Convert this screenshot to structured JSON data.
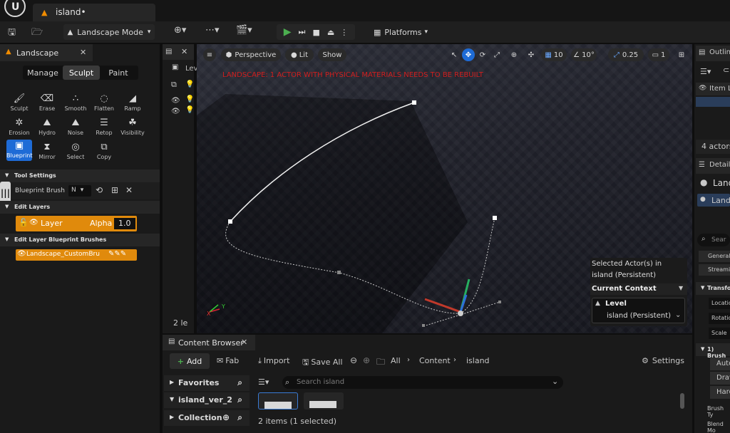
{
  "title_bar": {
    "doc_tab_label": "island•"
  },
  "toolbar": {
    "mode_label": "Landscape Mode",
    "platforms_label": "Platforms"
  },
  "left_panel": {
    "tab_title": "Landscape",
    "modes": [
      "Manage",
      "Sculpt",
      "Paint"
    ],
    "tools": [
      {
        "label": "Sculpt",
        "icon": "brush-icon"
      },
      {
        "label": "Erase",
        "icon": "eraser-icon"
      },
      {
        "label": "Smooth",
        "icon": "smooth-icon"
      },
      {
        "label": "Flatten",
        "icon": "flatten-icon"
      },
      {
        "label": "Ramp",
        "icon": "ramp-icon"
      },
      {
        "label": "Erosion",
        "icon": "erosion-icon"
      },
      {
        "label": "Hydro",
        "icon": "hydro-icon"
      },
      {
        "label": "Noise",
        "icon": "noise-icon"
      },
      {
        "label": "Retop",
        "icon": "retop-icon"
      },
      {
        "label": "Visibility",
        "icon": "visibility-icon"
      },
      {
        "label": "Blueprint",
        "icon": "blueprint-icon"
      },
      {
        "label": "Mirror",
        "icon": "mirror-icon"
      },
      {
        "label": "Select",
        "icon": "select-icon"
      },
      {
        "label": "Copy",
        "icon": "copy-icon"
      }
    ],
    "tool_settings_header": "Tool Settings",
    "blueprint_brush_label": "Blueprint Brush",
    "blueprint_brush_value": "N",
    "edit_layers_header": "Edit Layers",
    "layer_label": "Layer",
    "alpha_label": "Alpha",
    "alpha_value": "1.0",
    "bp_brushes_header": "Edit Layer Blueprint Brushes",
    "bp_brush_item": "Landscape_CustomBru"
  },
  "mid_panel": {
    "tab_label": "Lev",
    "footer": "2 le"
  },
  "viewport": {
    "perspective_label": "Perspective",
    "lit_label": "Lit",
    "show_label": "Show",
    "grid_snap_value": "10",
    "rotation_snap_value": "10°",
    "scale_snap_value": "0.25",
    "camera_speed_value": "1",
    "warning_text": "LANDSCAPE: 1 ACTOR WITH PHYSICAL MATERIALS NEEDS TO BE REBUILT",
    "axis_x_label": "X",
    "axis_y_label": "Y",
    "colors": {
      "warning": "#d01e1e",
      "accent": "#1e6bd6",
      "layer": "#e08a0c"
    }
  },
  "context_popup": {
    "line1": "Selected Actor(s) in",
    "line2": "island (Persistent)",
    "current_context_label": "Current Context",
    "level_label": "Level",
    "level_value": "island (Persistent)"
  },
  "right_panel": {
    "outliner_tab": "Outlin",
    "item_label_header": "Item L",
    "actors_count": "4 actors",
    "details_tab": "Details",
    "selected_name": "Landsca",
    "selected_item": "Land",
    "search_placeholder": "Sear",
    "filters": [
      "General",
      "Streamin"
    ],
    "transform_header": "Transfor",
    "transform_rows": [
      "Locatio",
      "Rotatio",
      "Scale"
    ],
    "brush_header": "1) Brush",
    "brush_buttons": [
      "Auto",
      "Draw",
      "Hard"
    ],
    "brush_type_label": "Brush Ty",
    "blend_mode_label": "Blend Mo"
  },
  "content_browser": {
    "tab_title": "Content Browser",
    "add_label": "Add",
    "fab_label": "Fab",
    "import_label": "Import",
    "save_all_label": "Save All",
    "breadcrumb": [
      "All",
      "Content",
      "island"
    ],
    "settings_label": "Settings",
    "sidebar": [
      "Favorites",
      "island_ver_2",
      "Collection"
    ],
    "search_placeholder": "Search island",
    "status": "2 items (1 selected)"
  }
}
